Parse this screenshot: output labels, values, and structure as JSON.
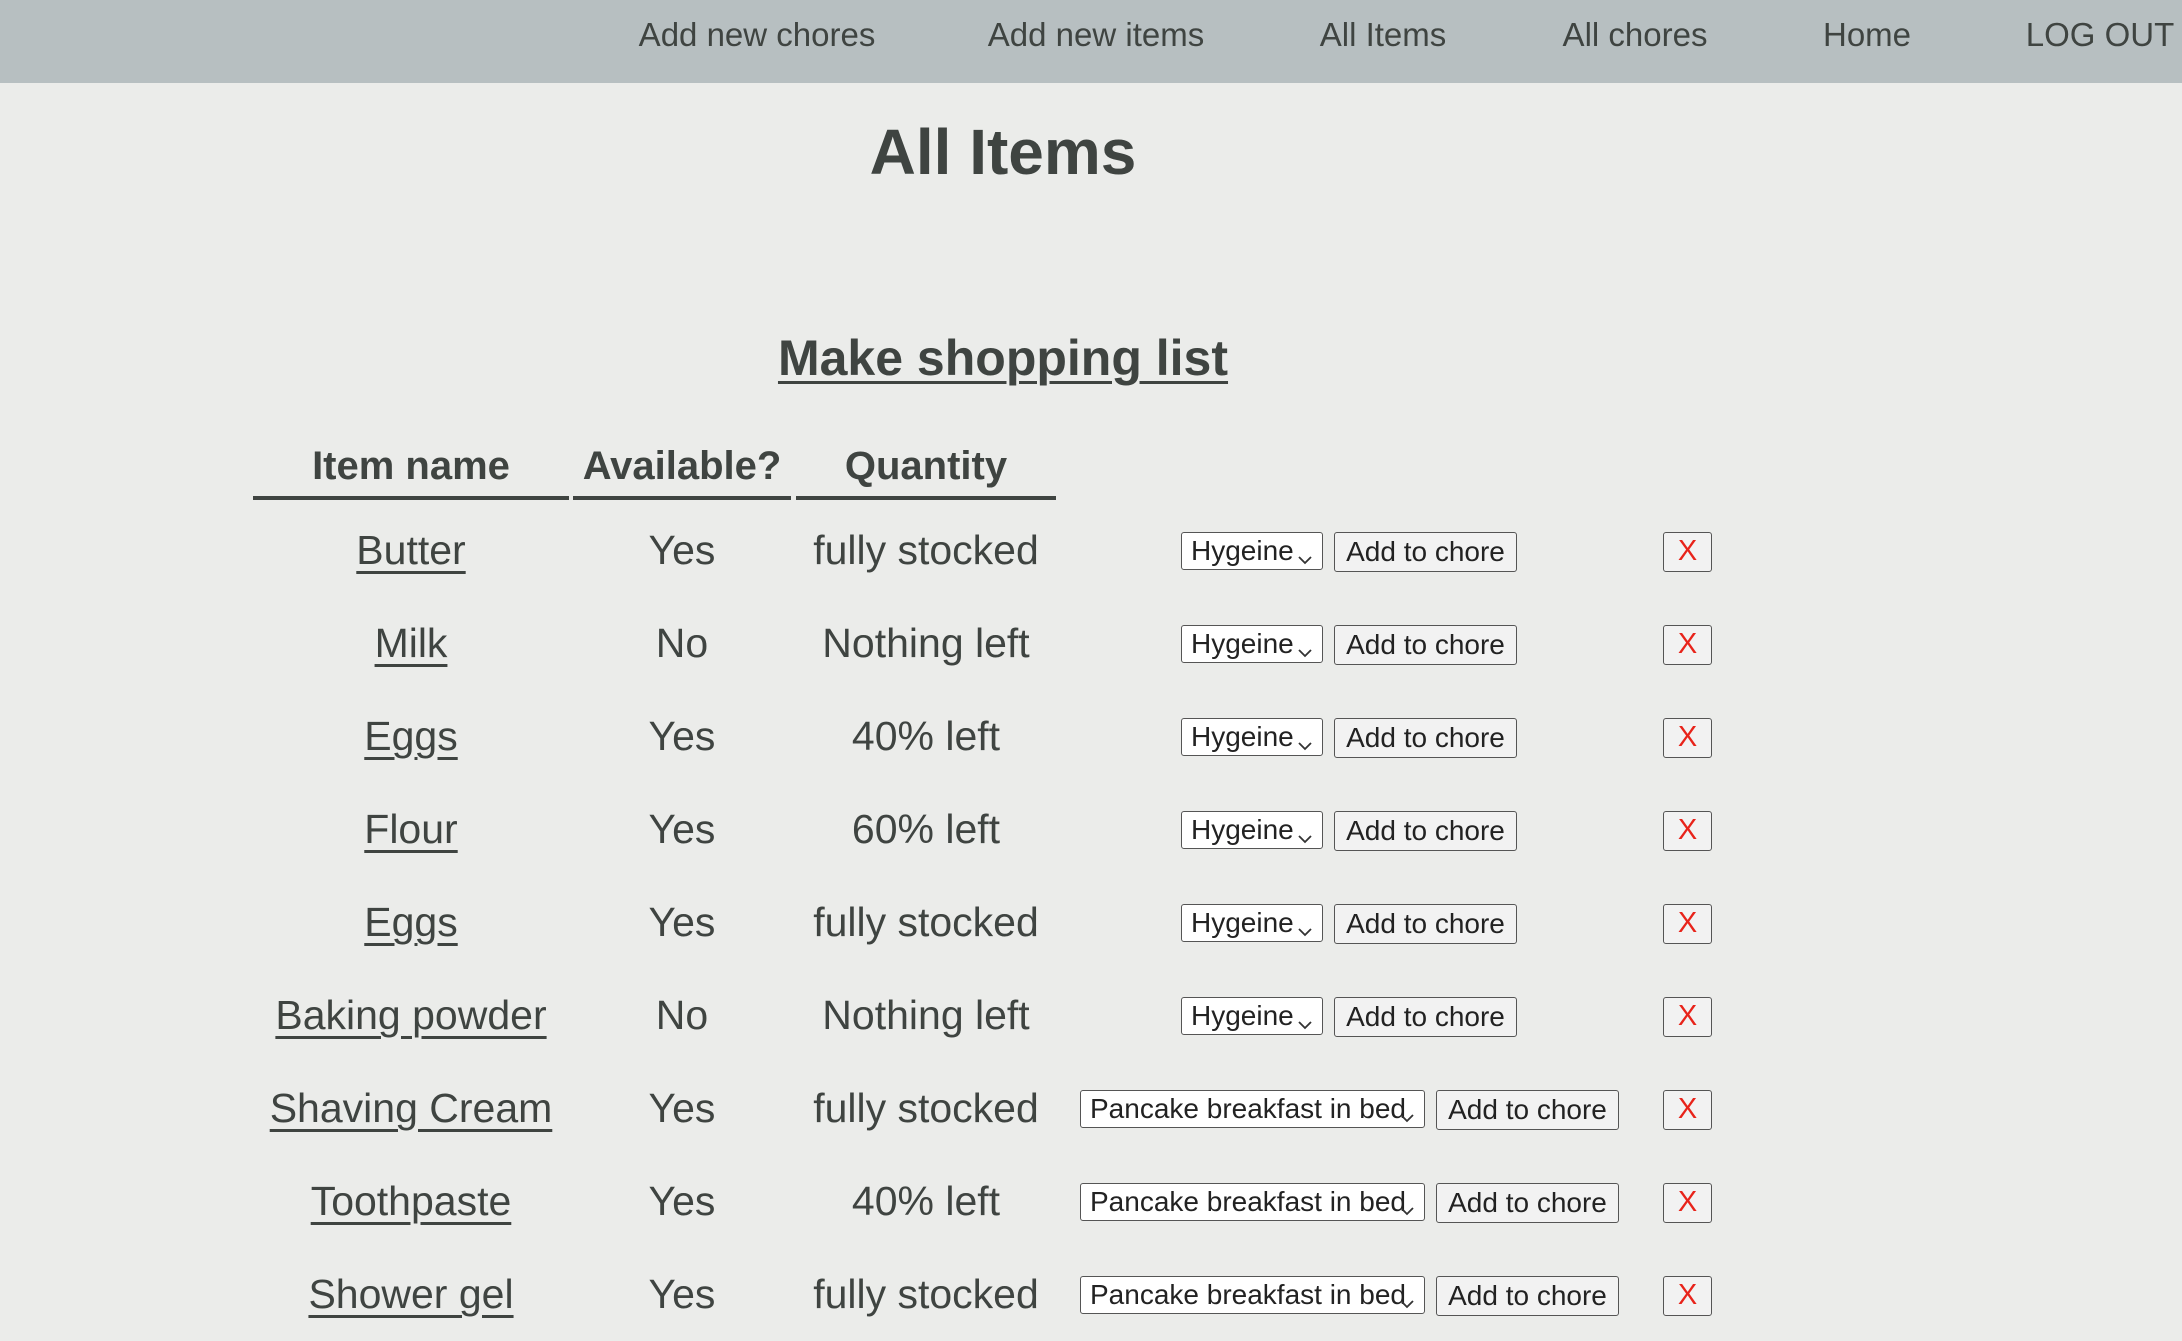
{
  "nav": {
    "add_new_chores": "Add new chores",
    "add_new_items": "Add new items",
    "all_items": "All Items",
    "all_chores": "All chores",
    "home": "Home",
    "log_out": "LOG OUT"
  },
  "page": {
    "title": "All Items",
    "shopping_link": "Make shopping list"
  },
  "table": {
    "headers": {
      "item_name": "Item name",
      "available": "Available?",
      "quantity": "Quantity"
    },
    "add_button_label": "Add to chore",
    "delete_button_label": "X",
    "rows": [
      {
        "name": "Butter",
        "available": "Yes",
        "quantity": "fully stocked",
        "chore": "Hygeine"
      },
      {
        "name": "Milk",
        "available": "No",
        "quantity": "Nothing left",
        "chore": "Hygeine"
      },
      {
        "name": "Eggs",
        "available": "Yes",
        "quantity": "40% left",
        "chore": "Hygeine"
      },
      {
        "name": "Flour",
        "available": "Yes",
        "quantity": "60% left",
        "chore": "Hygeine"
      },
      {
        "name": "Eggs",
        "available": "Yes",
        "quantity": "fully stocked",
        "chore": "Hygeine"
      },
      {
        "name": "Baking powder",
        "available": "No",
        "quantity": "Nothing left",
        "chore": "Hygeine"
      },
      {
        "name": "Shaving Cream",
        "available": "Yes",
        "quantity": "fully stocked",
        "chore": "Pancake breakfast in bed"
      },
      {
        "name": "Toothpaste",
        "available": "Yes",
        "quantity": "40% left",
        "chore": "Pancake breakfast in bed"
      },
      {
        "name": "Shower gel",
        "available": "Yes",
        "quantity": "fully stocked",
        "chore": "Pancake breakfast in bed"
      }
    ]
  },
  "colors": {
    "nav_bg": "#b7bfc1",
    "page_bg": "#ebecea",
    "text": "#3f4441",
    "delete_red": "#e8231a"
  },
  "icons": {
    "select_arrow": "chevron-down-icon"
  }
}
